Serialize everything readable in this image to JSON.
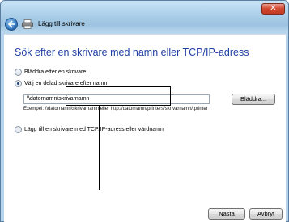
{
  "window": {
    "close_label": "✕"
  },
  "nav": {
    "title": "Lägg till skrivare"
  },
  "main": {
    "heading": "Sök efter en skrivare med namn eller TCP/IP-adress",
    "option_browse": "Bläddra efter en skrivare",
    "option_shared": "Välj en delad skrivare efter namn",
    "shared_input_value": "\\\\datornamn\\skrivarnamn",
    "browse_button": "Bläddra...",
    "example_text": "Exempel: \\\\datornamn\\skrivarnamn eller http://datornamn/printers/skrivarnamn/.printer",
    "option_tcpip": "Lägg till en skrivare med TCP/IP-adress eller värdnamn"
  },
  "footer": {
    "next_button": "Nästa",
    "cancel_button": "Avbryt"
  }
}
